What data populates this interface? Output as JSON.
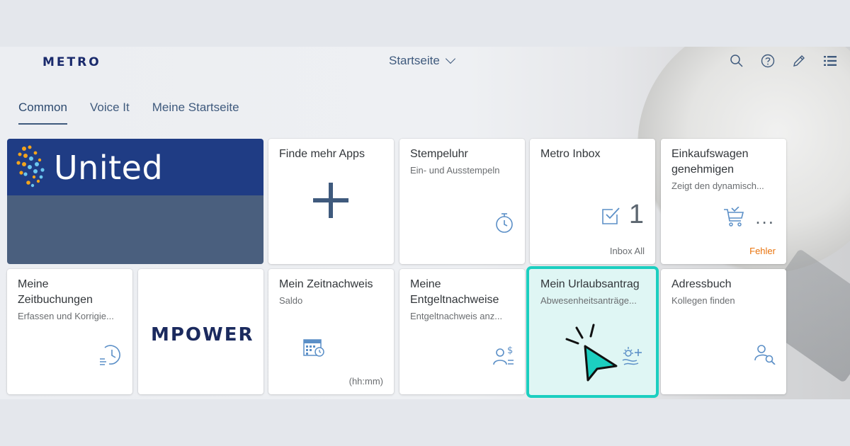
{
  "header": {
    "logo": "METRO",
    "title": "Startseite",
    "icons": [
      "search-icon",
      "help-icon",
      "edit-icon",
      "list-icon"
    ]
  },
  "tabs": [
    {
      "label": "Common",
      "active": true
    },
    {
      "label": "Voice It",
      "active": false
    },
    {
      "label": "Meine Startseite",
      "active": false
    }
  ],
  "tiles": {
    "united": {
      "label": "United"
    },
    "finde": {
      "title": "Finde mehr Apps",
      "icon": "plus-icon"
    },
    "stempeluhr": {
      "title": "Stempeluhr",
      "subtitle": "Ein- und Ausstempeln",
      "icon": "stopwatch-icon"
    },
    "inbox": {
      "title": "Metro Inbox",
      "count": "1",
      "footer": "Inbox All",
      "icon": "inbox-check-icon"
    },
    "einkauf": {
      "title": "Einkaufswagen genehmigen",
      "subtitle": "Zeigt den dynamisch...",
      "value": "...",
      "footer": "Fehler",
      "icon": "cart-approve-icon"
    },
    "zeitbuchungen": {
      "title": "Meine Zeitbuchungen",
      "subtitle": "Erfassen und Korrigie...",
      "icon": "time-entry-icon"
    },
    "mpower": {
      "label": "MPOWER"
    },
    "zeitnachweis": {
      "title": "Mein Zeitnachweis",
      "subtitle": "Saldo",
      "footer": "(hh:mm)",
      "icon": "calendar-clock-icon"
    },
    "entgelt": {
      "title": "Meine Entgeltnachweise",
      "subtitle": "Entgeltnachweis anz...",
      "icon": "employee-pay-icon"
    },
    "urlaub": {
      "title": "Mein Urlaubsantrag",
      "subtitle": "Abwesenheitsanträge...",
      "icon": "leave-request-icon"
    },
    "adressbuch": {
      "title": "Adressbuch",
      "subtitle": "Kollegen finden",
      "icon": "person-search-icon"
    }
  },
  "colors": {
    "accent": "#3f5a7d",
    "highlight": "#1ccfc0",
    "error": "#e9730c",
    "united_blue": "#1f3c84"
  }
}
